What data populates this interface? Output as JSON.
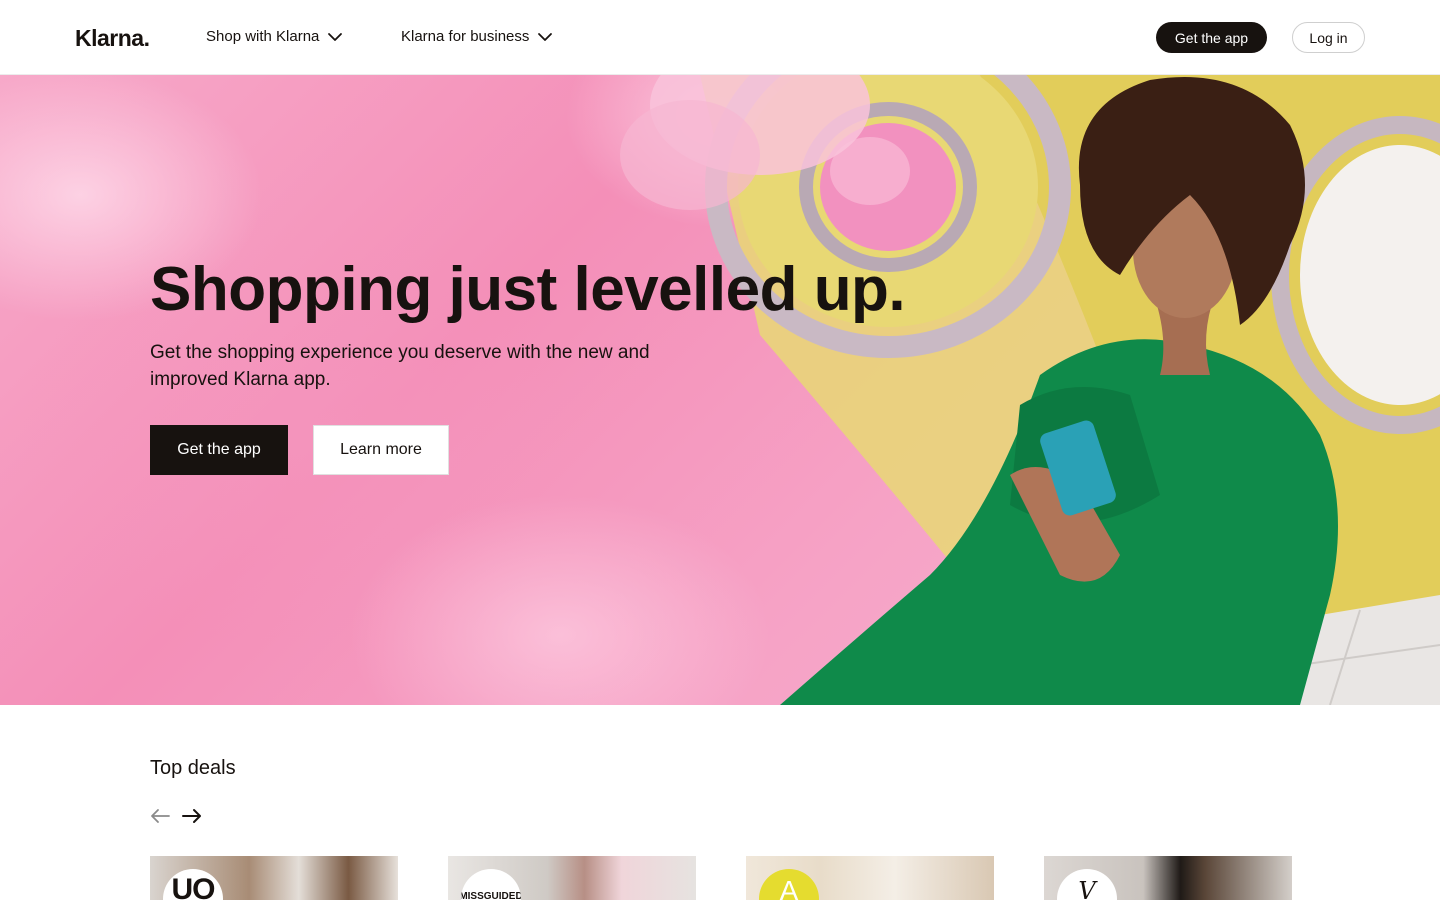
{
  "header": {
    "logo": "Klarna.",
    "nav": [
      {
        "label": "Shop with Klarna"
      },
      {
        "label": "Klarna for business"
      }
    ],
    "get_app_label": "Get the app",
    "login_label": "Log in"
  },
  "hero": {
    "title": "Shopping just levelled up.",
    "subtitle": "Get the shopping experience you deserve with the new and improved Klarna app.",
    "primary_button": "Get the app",
    "secondary_button": "Learn more"
  },
  "deals": {
    "title": "Top deals",
    "cards": [
      {
        "badge": "UO"
      },
      {
        "badge": "MISSGUIDED"
      },
      {
        "badge": "A"
      },
      {
        "badge": "V"
      }
    ]
  },
  "colors": {
    "brand_dark": "#17120f",
    "hero_pink": "#f48fb8",
    "dress_green": "#0f8a4a"
  },
  "icons": {
    "nav_dropdown": "chevron-down-icon",
    "prev": "arrow-left-icon",
    "next": "arrow-right-icon"
  }
}
